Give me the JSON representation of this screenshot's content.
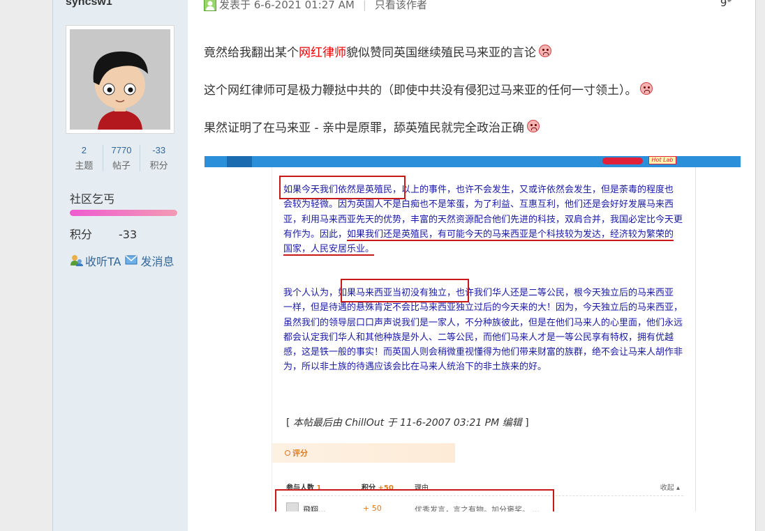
{
  "author": {
    "username": "syncsw1",
    "stats": [
      {
        "value": "2",
        "label": "主题"
      },
      {
        "value": "7770",
        "label": "帖子"
      },
      {
        "value": "-33",
        "label": "积分"
      }
    ],
    "rank": "社区乞丐",
    "credit_label": "积分",
    "credit_value": "-33",
    "follow_label": "收听TA",
    "message_label": "发消息"
  },
  "post": {
    "posted_label": "发表于 6-6-2021 01:27 AM",
    "author_only_label": "只看该作者",
    "floor": "9",
    "floor_sup": "#",
    "p1_a": "竟然给我翻出某个",
    "p1_red": "网红律师",
    "p1_b": "貌似赞同英国继续殖民马来亚的言论",
    "p2": "这个网红律师可是极力鞭挞中共的（即使中共没有侵犯过马来亚的任何一寸领土）。",
    "p3": "果然证明了在马来亚 - 亲中是原罪，舔英殖民就完全政治正确"
  },
  "screenshot": {
    "hot_badge": "Hot Lab",
    "q1_box": "如果今天我们依然是英殖民",
    "q1_a": "，以上的事件，也许不会发生，又或许依然会发生，但是荼毒的程度也会较为轻微。因为英国人不是白痴也不是笨蛋，为了利益、互惠互利，他们还是会好好发展马来西亚，利用马来西亚先天的优势，丰富的天然资源配合他们先进的科技，双肩合并，我国必定比今天更有作为。因此，",
    "q1_ul": "如果我们还是英殖民，有可能今天的马来西亚是个科技较为发达，经济较为繁荣的国家，人民安居乐业。",
    "q2_a": "我个人认为，",
    "q2_box": "如果马来西亚当初没有独立",
    "q2_b": "，也许我们华人还是二等公民，根今天独立后的马来西亚一样，但是待遇的悬殊肯定不会比马来西亚独立过后的今天来的大！因为，今天独立后的马来西亚，虽然我们的领导层口口声声说我们是一家人，不分种族彼此，但是在他们马来人的心里面，他们永远都会认定我们华人和其他种族是外人、二等公民，而他们马来人才是一等公民享有特权，拥有优越感，这是铁一般的事实！而英国人则会稍微重视懂得为他们带来财富的族群，绝不会让马来人胡作非为，所以非土族的待遇应该会比在马来人统治下的非土族来的好。",
    "edit_note_a": "[ ",
    "edit_note_i": "本帖最后由 ChillOut 于 11-6-2007 03:21 PM 编辑",
    "edit_note_b": " ]",
    "rate_title": "评分",
    "col_participants": "参与人数",
    "col_participants_n": "1",
    "col_score": "积分",
    "col_score_n": "+50",
    "col_reason": "理由",
    "collapse": "收起",
    "rater_name": "飛翔...",
    "rater_score": "+ 50",
    "rater_reason": "优秀发言，言之有物。加分褒奖。 ..."
  }
}
